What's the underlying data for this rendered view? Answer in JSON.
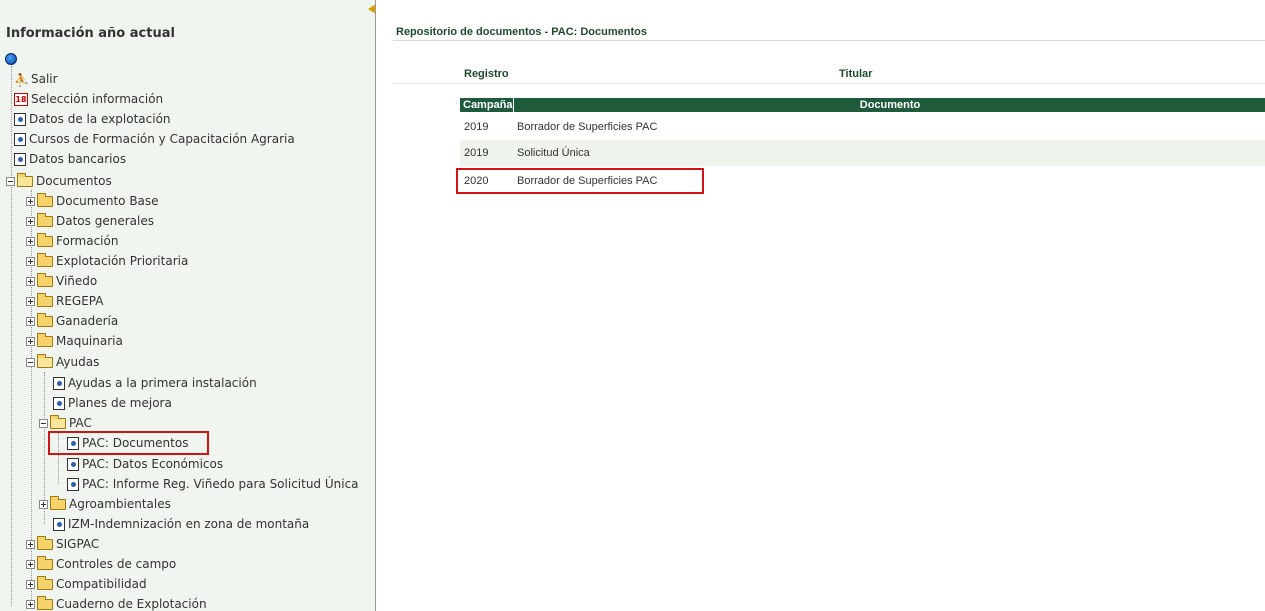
{
  "sidebar": {
    "title": "Información año actual",
    "items": [
      {
        "label": "Salir"
      },
      {
        "label": "Selección información",
        "icon_text": "18"
      },
      {
        "label": "Datos de la explotación"
      },
      {
        "label": "Cursos de Formación y Capacitación Agraria"
      },
      {
        "label": "Datos bancarios"
      },
      {
        "label": "Documentos"
      },
      {
        "label": "Documento Base"
      },
      {
        "label": "Datos generales"
      },
      {
        "label": "Formación"
      },
      {
        "label": "Explotación Prioritaria"
      },
      {
        "label": "Viñedo"
      },
      {
        "label": "REGEPA"
      },
      {
        "label": "Ganadería"
      },
      {
        "label": "Maquinaria"
      },
      {
        "label": "Ayudas"
      },
      {
        "label": "Ayudas a la primera instalación"
      },
      {
        "label": "Planes de mejora"
      },
      {
        "label": "PAC"
      },
      {
        "label": "PAC: Documentos"
      },
      {
        "label": "PAC: Datos Económicos"
      },
      {
        "label": "PAC: Informe Reg. Viñedo para Solicitud Única"
      },
      {
        "label": "Agroambientales"
      },
      {
        "label": "IZM-Indemnización en zona de montaña"
      },
      {
        "label": "SIGPAC"
      },
      {
        "label": "Controles de campo"
      },
      {
        "label": "Compatibilidad"
      },
      {
        "label": "Cuaderno de Explotación"
      }
    ]
  },
  "main": {
    "title": "Repositorio de documentos - PAC: Documentos",
    "header": {
      "registro": "Registro",
      "titular": "Titular"
    },
    "table": {
      "columns": [
        "Campaña",
        "Documento"
      ],
      "rows": [
        {
          "year": "2019",
          "doc": "Borrador de Superficies PAC"
        },
        {
          "year": "2019",
          "doc": "Solicitud Única"
        },
        {
          "year": "2020",
          "doc": "Borrador de Superficies PAC"
        }
      ]
    }
  },
  "colors": {
    "accent": "#1e5b3a",
    "panel_bg": "#f1f5ef",
    "highlight": "#d21414"
  }
}
